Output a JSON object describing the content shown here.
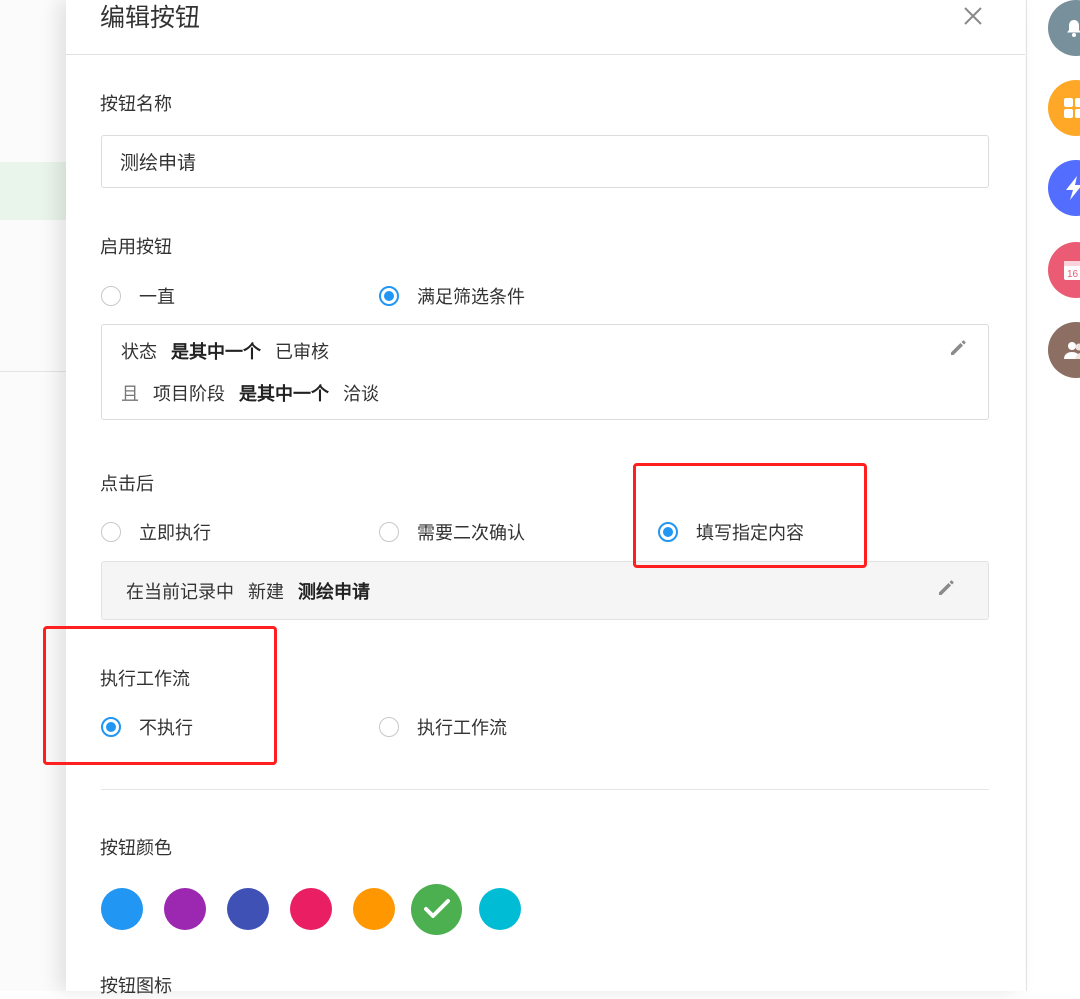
{
  "dialog": {
    "title": "编辑按钮"
  },
  "button_name": {
    "label": "按钮名称",
    "value": "测绘申请"
  },
  "enable": {
    "label": "启用按钮",
    "options": [
      "一直",
      "满足筛选条件"
    ],
    "selected": "满足筛选条件",
    "conditions": [
      {
        "connector": "",
        "field": "状态",
        "operator": "是其中一个",
        "value": "已审核"
      },
      {
        "connector": "且",
        "field": "项目阶段",
        "operator": "是其中一个",
        "value": "洽谈"
      }
    ]
  },
  "after_click": {
    "label": "点击后",
    "options": [
      "立即执行",
      "需要二次确认",
      "填写指定内容"
    ],
    "selected": "填写指定内容",
    "action": {
      "prefix": "在当前记录中",
      "verb": "新建",
      "target": "测绘申请"
    }
  },
  "workflow": {
    "label": "执行工作流",
    "options": [
      "不执行",
      "执行工作流"
    ],
    "selected": "不执行"
  },
  "color": {
    "label": "按钮颜色",
    "swatches": [
      "#2196f3",
      "#9c27b0",
      "#3f51b5",
      "#e91e63",
      "#ff9800",
      "#4caf50",
      "#00bcd4"
    ],
    "selected": "#4caf50"
  },
  "icon_section": {
    "label": "按钮图标"
  },
  "sidebar_icons": [
    {
      "icon": "bell-icon",
      "color": "#78909c"
    },
    {
      "icon": "apps-icon",
      "color": "#ffa726"
    },
    {
      "icon": "flash-icon",
      "color": "#536dfe"
    },
    {
      "icon": "calendar-icon",
      "color": "#ec5b74",
      "text": "16"
    },
    {
      "icon": "contacts-icon",
      "color": "#8d6e63"
    }
  ],
  "annotation_color": "#ff1f1f"
}
